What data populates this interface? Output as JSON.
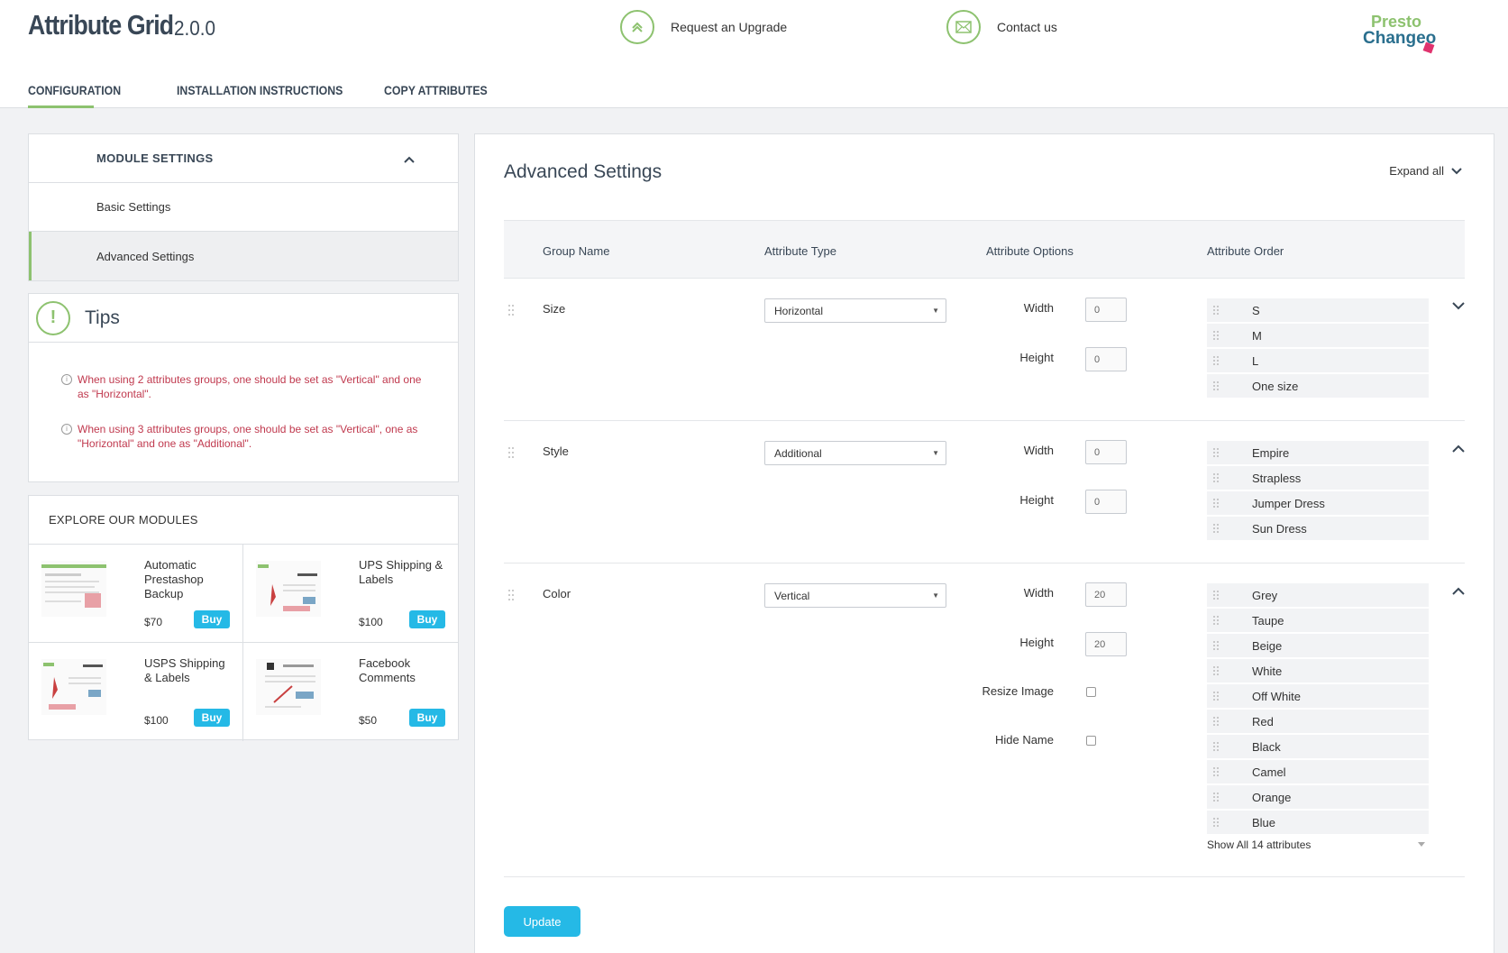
{
  "header": {
    "title": "Attribute Grid",
    "version": "2.0.0",
    "upgrade_label": "Request an Upgrade",
    "contact_label": "Contact us",
    "logo_text_top": "Presto",
    "logo_text_bottom": "Changeo"
  },
  "tabs": [
    {
      "label": "CONFIGURATION",
      "active": true
    },
    {
      "label": "INSTALLATION INSTRUCTIONS",
      "active": false
    },
    {
      "label": "COPY ATTRIBUTES",
      "active": false
    }
  ],
  "module_settings": {
    "title": "MODULE SETTINGS",
    "items": [
      "Basic Settings",
      "Advanced Settings"
    ],
    "active_item": "Advanced Settings"
  },
  "tips": {
    "title": "Tips",
    "items": [
      "When using 2 attributes groups, one should be set as \"Vertical\" and one as \"Horizontal\".",
      "When using 3 attributes groups, one should be set as \"Vertical\", one as \"Horizontal\" and one as \"Additional\"."
    ]
  },
  "explore": {
    "title": "EXPLORE OUR MODULES",
    "buy_label": "Buy",
    "modules": [
      {
        "name": "Automatic Prestashop Backup",
        "price": "$70"
      },
      {
        "name": "UPS Shipping & Labels",
        "price": "$100"
      },
      {
        "name": "USPS Shipping & Labels",
        "price": "$100"
      },
      {
        "name": "Facebook Comments",
        "price": "$50"
      }
    ]
  },
  "main": {
    "title": "Advanced Settings",
    "expand_all": "Expand all",
    "columns": [
      "Group Name",
      "Attribute Type",
      "Attribute Options",
      "Attribute Order"
    ],
    "labels": {
      "width": "Width",
      "height": "Height",
      "resize_image": "Resize Image",
      "hide_name": "Hide Name"
    },
    "groups": [
      {
        "name": "Size",
        "type": "Horizontal",
        "width": "0",
        "height": "0",
        "options": [
          "S",
          "M",
          "L",
          "One size"
        ]
      },
      {
        "name": "Style",
        "type": "Additional",
        "width": "0",
        "height": "0",
        "options": [
          "Empire",
          "Strapless",
          "Jumper Dress",
          "Sun Dress"
        ]
      },
      {
        "name": "Color",
        "type": "Vertical",
        "width": "20",
        "height": "20",
        "resize_image": false,
        "hide_name": false,
        "options": [
          "Grey",
          "Taupe",
          "Beige",
          "White",
          "Off White",
          "Red",
          "Black",
          "Camel",
          "Orange",
          "Blue"
        ],
        "show_all": "Show All 14 attributes"
      }
    ],
    "update_label": "Update"
  },
  "colors": {
    "accent_green": "#8dc26f",
    "button_blue": "#25b9e6",
    "tip_red": "#c0394e",
    "title_dark": "#394756"
  }
}
